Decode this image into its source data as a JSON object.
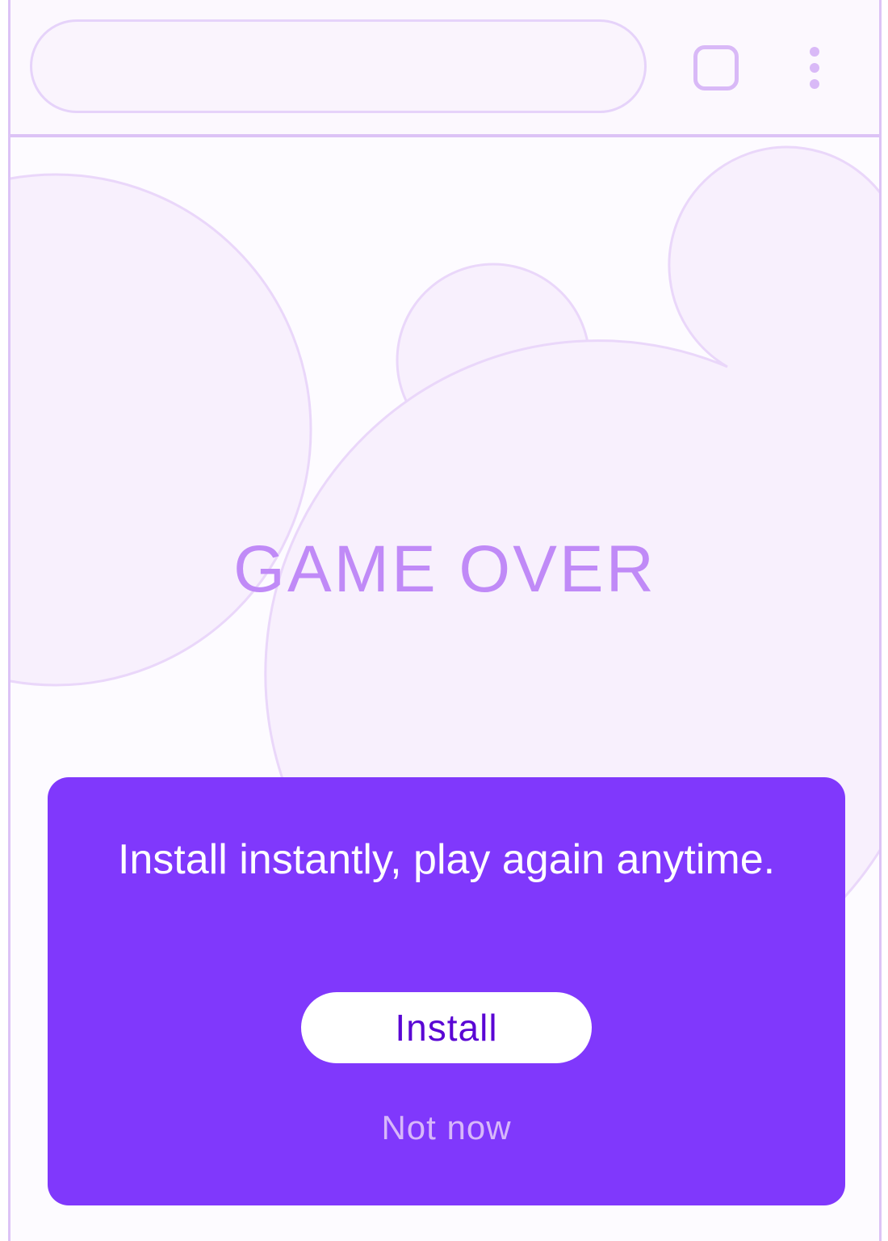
{
  "browser": {
    "address_value": "",
    "tabs_icon": "tab-switcher-icon",
    "menu_icon": "more-vert-icon"
  },
  "game": {
    "status_text": "GAME OVER"
  },
  "install_prompt": {
    "message": "Install instantly, play again anytime.",
    "install_label": "Install",
    "dismiss_label": "Not now"
  },
  "colors": {
    "accent": "#8038FC",
    "title": "#C08AF7",
    "install_text": "#5A06D4",
    "dismiss_text": "#D7B7FA",
    "outline": "#DCC3F6"
  }
}
